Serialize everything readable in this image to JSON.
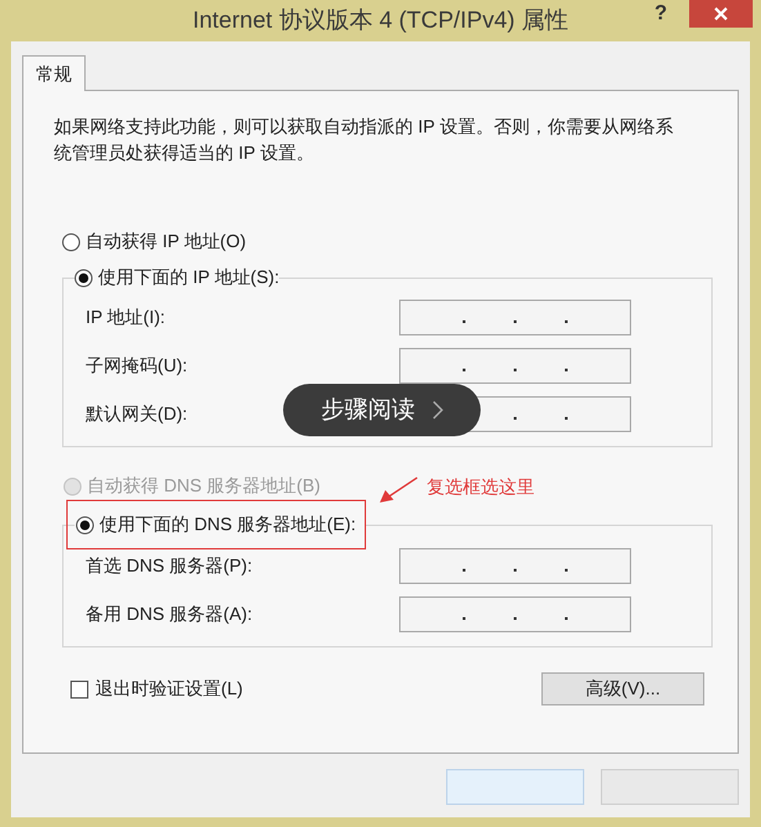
{
  "window": {
    "title": "Internet 协议版本 4 (TCP/IPv4) 属性",
    "help": "?"
  },
  "tabs": [
    {
      "label": "常规",
      "selected": true
    }
  ],
  "description": "如果网络支持此功能，则可以获取自动指派的 IP 设置。否则，你需要从网络系统管理员处获得适当的 IP 设置。",
  "ip_mode": [
    {
      "label": "自动获得 IP 地址(O)",
      "selected": false,
      "disabled": false
    },
    {
      "label": "使用下面的 IP 地址(S):",
      "selected": true,
      "disabled": false
    }
  ],
  "ip_fields": [
    {
      "label": "IP 地址(I):"
    },
    {
      "label": "子网掩码(U):"
    },
    {
      "label": "默认网关(D):"
    }
  ],
  "dns_mode": [
    {
      "label": "自动获得 DNS 服务器地址(B)",
      "selected": false,
      "disabled": true,
      "highlighted": false
    },
    {
      "label": "使用下面的 DNS 服务器地址(E):",
      "selected": true,
      "disabled": false,
      "highlighted": true
    }
  ],
  "dns_fields": [
    {
      "label": "首选 DNS 服务器(P):"
    },
    {
      "label": "备用 DNS 服务器(A):"
    }
  ],
  "validate_on_exit": {
    "label": "退出时验证设置(L)",
    "checked": false
  },
  "advanced_button": "高级(V)...",
  "annotation": {
    "text": "复选框选这里"
  },
  "overlay": {
    "label": "步骤阅读"
  }
}
